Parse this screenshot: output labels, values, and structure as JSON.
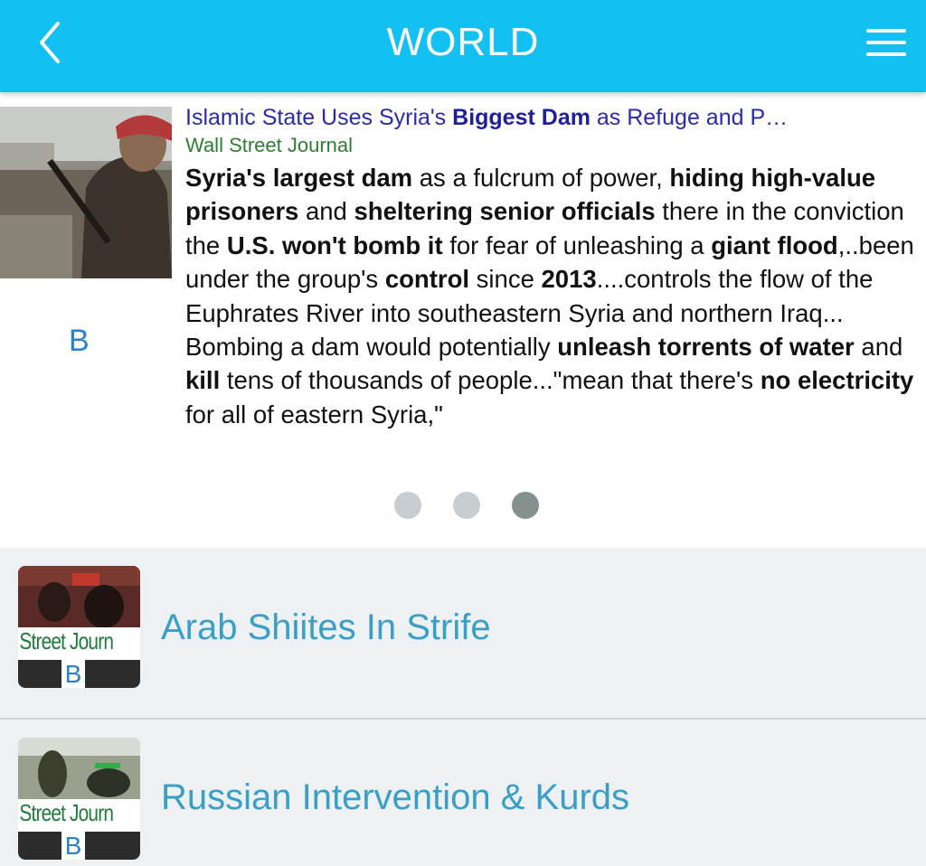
{
  "header": {
    "title": "WORLD",
    "back_icon": "chevron-left-icon",
    "menu_icon": "hamburger-menu-icon",
    "bar_color": "#13c0f2"
  },
  "featured": {
    "title_start": "Islamic State Uses Syria's ",
    "title_bold": "Biggest Dam",
    "title_end": " as Refuge and P…",
    "source": "Wall Street Journal",
    "badge": "B",
    "snippet": [
      {
        "t": "Syria's largest dam",
        "b": true
      },
      {
        "t": " as a fulcrum of power, ",
        "b": false
      },
      {
        "t": "hiding high-value prisoners",
        "b": true
      },
      {
        "t": " and ",
        "b": false
      },
      {
        "t": "sheltering senior officials",
        "b": true
      },
      {
        "t": " there in the conviction the ",
        "b": false
      },
      {
        "t": "U.S. won't bomb it",
        "b": true
      },
      {
        "t": " for fear of unleashing a ",
        "b": false
      },
      {
        "t": "giant flood",
        "b": true
      },
      {
        "t": ",..been under the group's ",
        "b": false
      },
      {
        "t": "control",
        "b": true
      },
      {
        "t": " since ",
        "b": false
      },
      {
        "t": "2013",
        "b": true
      },
      {
        "t": "....controls the flow of the Euphrates River into southeastern Syria and northern Iraq... Bombing a dam would potentially ",
        "b": false
      },
      {
        "t": "unleash torrents of water",
        "b": true
      },
      {
        "t": " and ",
        "b": false
      },
      {
        "t": "kill",
        "b": true
      },
      {
        "t": " tens of thousands of people...\"mean that there's ",
        "b": false
      },
      {
        "t": "no electricity",
        "b": true
      },
      {
        "t": " for all of eastern Syria,\"",
        "b": false
      }
    ]
  },
  "pager": {
    "count": 3,
    "active_index": 2
  },
  "list": [
    {
      "title": "Arab Shiites In Strife",
      "thumb_source": "all Street Journ",
      "thumb_badge": "B"
    },
    {
      "title": "Russian Intervention & Kurds",
      "thumb_source": "all Street Journ",
      "thumb_badge": "B"
    }
  ]
}
